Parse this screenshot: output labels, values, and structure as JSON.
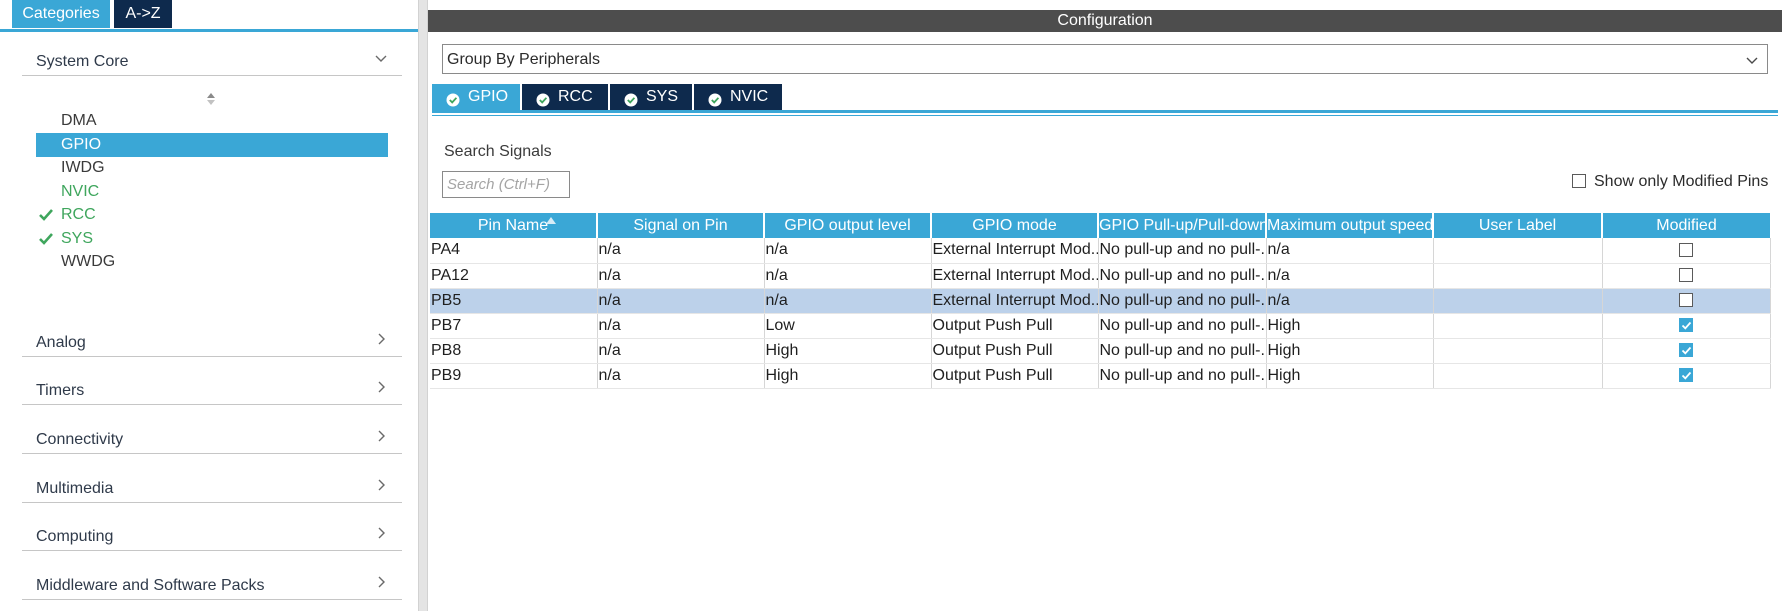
{
  "left": {
    "tabs": {
      "categories": "Categories",
      "az": "A->Z"
    },
    "categories": [
      {
        "label": "System Core",
        "expanded": true,
        "icon": "chevron-down-icon"
      },
      {
        "label": "Analog",
        "icon": "chevron-right-icon"
      },
      {
        "label": "Timers",
        "icon": "chevron-right-icon"
      },
      {
        "label": "Connectivity",
        "icon": "chevron-right-icon"
      },
      {
        "label": "Multimedia",
        "icon": "chevron-right-icon"
      },
      {
        "label": "Computing",
        "icon": "chevron-right-icon"
      },
      {
        "label": "Middleware and Software Packs",
        "icon": "chevron-right-icon"
      }
    ],
    "system_core_items": [
      {
        "label": "DMA",
        "state": "plain"
      },
      {
        "label": "GPIO",
        "state": "selected"
      },
      {
        "label": "IWDG",
        "state": "plain"
      },
      {
        "label": "NVIC",
        "state": "green"
      },
      {
        "label": "RCC",
        "state": "green-check"
      },
      {
        "label": "SYS",
        "state": "green-check"
      },
      {
        "label": "WWDG",
        "state": "plain"
      }
    ]
  },
  "right": {
    "header": "Configuration",
    "group_select": "Group By Peripherals",
    "ip_tabs": [
      "GPIO",
      "RCC",
      "SYS",
      "NVIC"
    ],
    "search_title": "Search Signals",
    "search_placeholder": "Search (Ctrl+F)",
    "show_modified_label": "Show only Modified Pins",
    "table": {
      "columns": [
        "Pin Name",
        "Signal on Pin",
        "GPIO output level",
        "GPIO mode",
        "GPIO Pull-up/Pull-down",
        "Maximum output speed",
        "User Label",
        "Modified"
      ],
      "rows": [
        {
          "pin": "PA4",
          "signal": "n/a",
          "level": "n/a",
          "mode": "External Interrupt Mod...",
          "pull": "No pull-up and no pull-...",
          "speed": "n/a",
          "label": "",
          "modified": false
        },
        {
          "pin": "PA12",
          "signal": "n/a",
          "level": "n/a",
          "mode": "External Interrupt Mod...",
          "pull": "No pull-up and no pull-...",
          "speed": "n/a",
          "label": "",
          "modified": false
        },
        {
          "pin": "PB5",
          "signal": "n/a",
          "level": "n/a",
          "mode": "External Interrupt Mod...",
          "pull": "No pull-up and no pull-...",
          "speed": "n/a",
          "label": "",
          "modified": false,
          "selected": true
        },
        {
          "pin": "PB7",
          "signal": "n/a",
          "level": "Low",
          "mode": "Output Push Pull",
          "pull": "No pull-up and no pull-...",
          "speed": "High",
          "label": "",
          "modified": true
        },
        {
          "pin": "PB8",
          "signal": "n/a",
          "level": "High",
          "mode": "Output Push Pull",
          "pull": "No pull-up and no pull-...",
          "speed": "High",
          "label": "",
          "modified": true
        },
        {
          "pin": "PB9",
          "signal": "n/a",
          "level": "High",
          "mode": "Output Push Pull",
          "pull": "No pull-up and no pull-...",
          "speed": "High",
          "label": "",
          "modified": true
        }
      ]
    }
  },
  "colors": {
    "accent": "#3aa7d6",
    "dark_tab": "#0e2a4d",
    "header": "#4d4d4d",
    "green": "#3fa65d",
    "selected_row": "#bcd1ea"
  }
}
